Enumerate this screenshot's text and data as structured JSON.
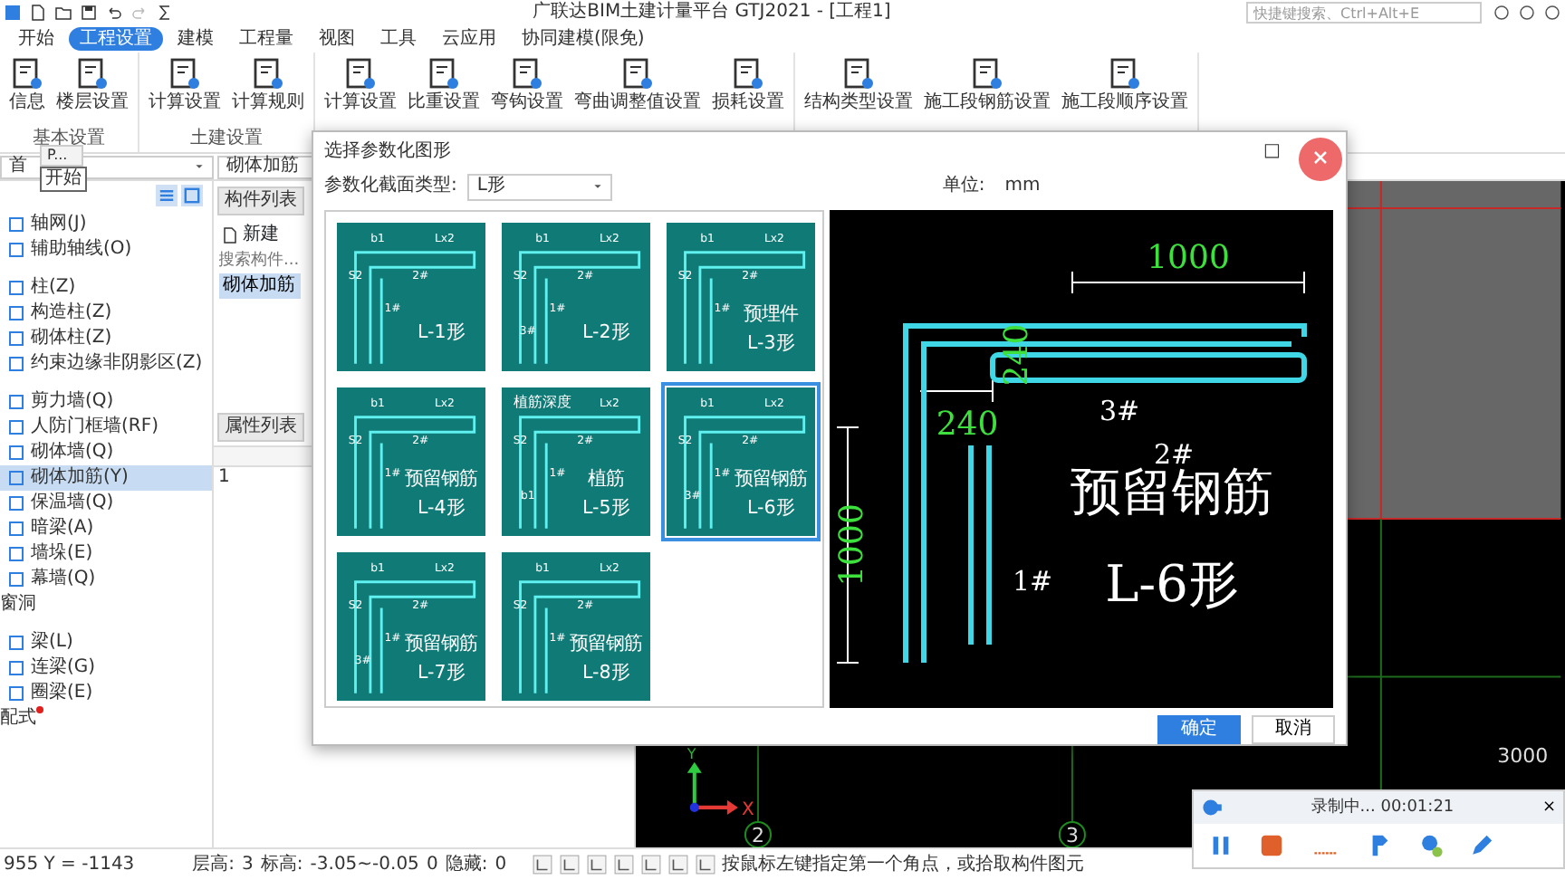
{
  "title_bar": {
    "title": "广联达BIM土建计量平台 GTJ2021 - [工程1]",
    "search": {
      "placeholder": "快捷键搜索、Ctrl+Alt+E"
    }
  },
  "menu_tabs": [
    {
      "label": "开始",
      "selected": false
    },
    {
      "label": "工程设置",
      "selected": true
    },
    {
      "label": "建模",
      "selected": false
    },
    {
      "label": "工程量",
      "selected": false
    },
    {
      "label": "视图",
      "selected": false
    },
    {
      "label": "工具",
      "selected": false
    },
    {
      "label": "云应用",
      "selected": false
    },
    {
      "label": "协同建模(限免)",
      "selected": false
    }
  ],
  "ribbon": {
    "groups": [
      {
        "label": "基本设置",
        "buttons": [
          "信息",
          "楼层设置"
        ]
      },
      {
        "label": "土建设置",
        "buttons": [
          "计算设置",
          "计算规则"
        ]
      },
      {
        "buttons": [
          "计算设置",
          "比重设置",
          "弯钩设置",
          "弯曲调整值设置",
          "损耗设置"
        ]
      },
      {
        "buttons": [
          "结构类型设置",
          "施工段钢筋设置",
          "施工段顺序设置"
        ]
      }
    ]
  },
  "tooltip": {
    "header": "P...",
    "text": "开始"
  },
  "left_panel": {
    "floor_dropdown": "首",
    "items": [
      {
        "kind": "item",
        "label": "轴网(J)",
        "selected": false
      },
      {
        "kind": "item",
        "label": "辅助轴线(O)",
        "selected": false
      },
      {
        "kind": "gap"
      },
      {
        "kind": "item",
        "label": "柱(Z)",
        "selected": false
      },
      {
        "kind": "item",
        "label": "构造柱(Z)",
        "selected": false
      },
      {
        "kind": "item",
        "label": "砌体柱(Z)",
        "selected": false
      },
      {
        "kind": "item",
        "label": "约束边缘非阴影区(Z)",
        "selected": false
      },
      {
        "kind": "gap"
      },
      {
        "kind": "item",
        "label": "剪力墙(Q)",
        "selected": false
      },
      {
        "kind": "item",
        "label": "人防门框墙(RF)",
        "selected": false
      },
      {
        "kind": "item",
        "label": "砌体墙(Q)",
        "selected": false
      },
      {
        "kind": "item",
        "label": "砌体加筋(Y)",
        "selected": true
      },
      {
        "kind": "item",
        "label": "保温墙(Q)",
        "selected": false
      },
      {
        "kind": "item",
        "label": "暗梁(A)",
        "selected": false
      },
      {
        "kind": "item",
        "label": "墙垛(E)",
        "selected": false
      },
      {
        "kind": "item",
        "label": "幕墙(Q)",
        "selected": false
      },
      {
        "kind": "header",
        "label": "窗洞",
        "new": false
      },
      {
        "kind": "gap"
      },
      {
        "kind": "item",
        "label": "梁(L)",
        "selected": false
      },
      {
        "kind": "item",
        "label": "连梁(G)",
        "selected": false
      },
      {
        "kind": "item",
        "label": "圈梁(E)",
        "selected": false
      },
      {
        "kind": "header",
        "label": "配式",
        "new": true
      }
    ]
  },
  "component_panel": {
    "type_dropdown": "砌体加筋",
    "list_tab": "构件列表",
    "new_button": "新建",
    "search": {
      "placeholder": "搜索构件..."
    },
    "items": [
      {
        "label": "砌体加筋",
        "selected": true
      }
    ],
    "property_tab": "属性列表",
    "property_rows": [
      "1"
    ]
  },
  "canvas": {
    "dimension": "3000",
    "axis_labels": [
      "2",
      "3"
    ],
    "axis_x": "X",
    "axis_y": "Y"
  },
  "status_bar": {
    "coords": "955 Y = -1143",
    "items": [
      "层高:",
      "3",
      "标高:",
      "-3.05~-0.05",
      "0",
      "隐藏:",
      "0"
    ],
    "hint": "按鼠标左键指定第一个角点，或拾取构件图元"
  },
  "dialog": {
    "title": "选择参数化图形",
    "maximize": "□",
    "section_type_label": "参数化截面类型:",
    "section_type": "L形",
    "unit_label": "单位:",
    "unit": "mm",
    "shapes": [
      {
        "captions": [
          "L-1形"
        ],
        "marks": [
          "b1",
          "Lx2",
          "S2",
          "2#",
          "1#"
        ],
        "selected": false
      },
      {
        "captions": [
          "L-2形"
        ],
        "marks": [
          "b1",
          "Lx2",
          "S2",
          "2#",
          "1#",
          "3#"
        ],
        "selected": false
      },
      {
        "captions": [
          "预埋件",
          "L-3形"
        ],
        "marks": [
          "b1",
          "Lx2",
          "S2",
          "2#",
          "1#"
        ],
        "selected": false
      },
      {
        "captions": [
          "预留钢筋",
          "L-4形"
        ],
        "marks": [
          "b1",
          "Lx2",
          "S2",
          "2#",
          "1#"
        ],
        "selected": false
      },
      {
        "captions": [
          "植筋",
          "L-5形"
        ],
        "marks": [
          "植筋深度",
          "Lx2",
          "S2",
          "2#",
          "1#",
          "b1"
        ],
        "selected": false
      },
      {
        "captions": [
          "预留钢筋",
          "L-6形"
        ],
        "marks": [
          "b1",
          "Lx2",
          "S2",
          "2#",
          "1#",
          "3#"
        ],
        "selected": true
      },
      {
        "captions": [
          "预留钢筋",
          "L-7形"
        ],
        "marks": [
          "b1",
          "Lx2",
          "S2",
          "2#",
          "1#",
          "3#"
        ],
        "selected": false
      },
      {
        "captions": [
          "预留钢筋",
          "L-8形"
        ],
        "marks": [
          "b1",
          "Lx2",
          "S2",
          "2#",
          "1#"
        ],
        "selected": false
      }
    ],
    "preview_labels": [
      {
        "text": "1000",
        "kind": "dim"
      },
      {
        "text": "240",
        "kind": "dim"
      },
      {
        "text": "3#",
        "kind": "label"
      },
      {
        "text": "2#",
        "kind": "label"
      },
      {
        "text": "240",
        "kind": "dim"
      },
      {
        "text": "1000",
        "kind": "dim"
      },
      {
        "text": "1#",
        "kind": "label"
      },
      {
        "text": "预留钢筋",
        "kind": "caption"
      },
      {
        "text": "L-6形",
        "kind": "caption"
      }
    ],
    "ok_button": "确定",
    "cancel_button": "取消"
  },
  "recorder": {
    "status": "录制中... 00:01:21",
    "close": "×"
  }
}
